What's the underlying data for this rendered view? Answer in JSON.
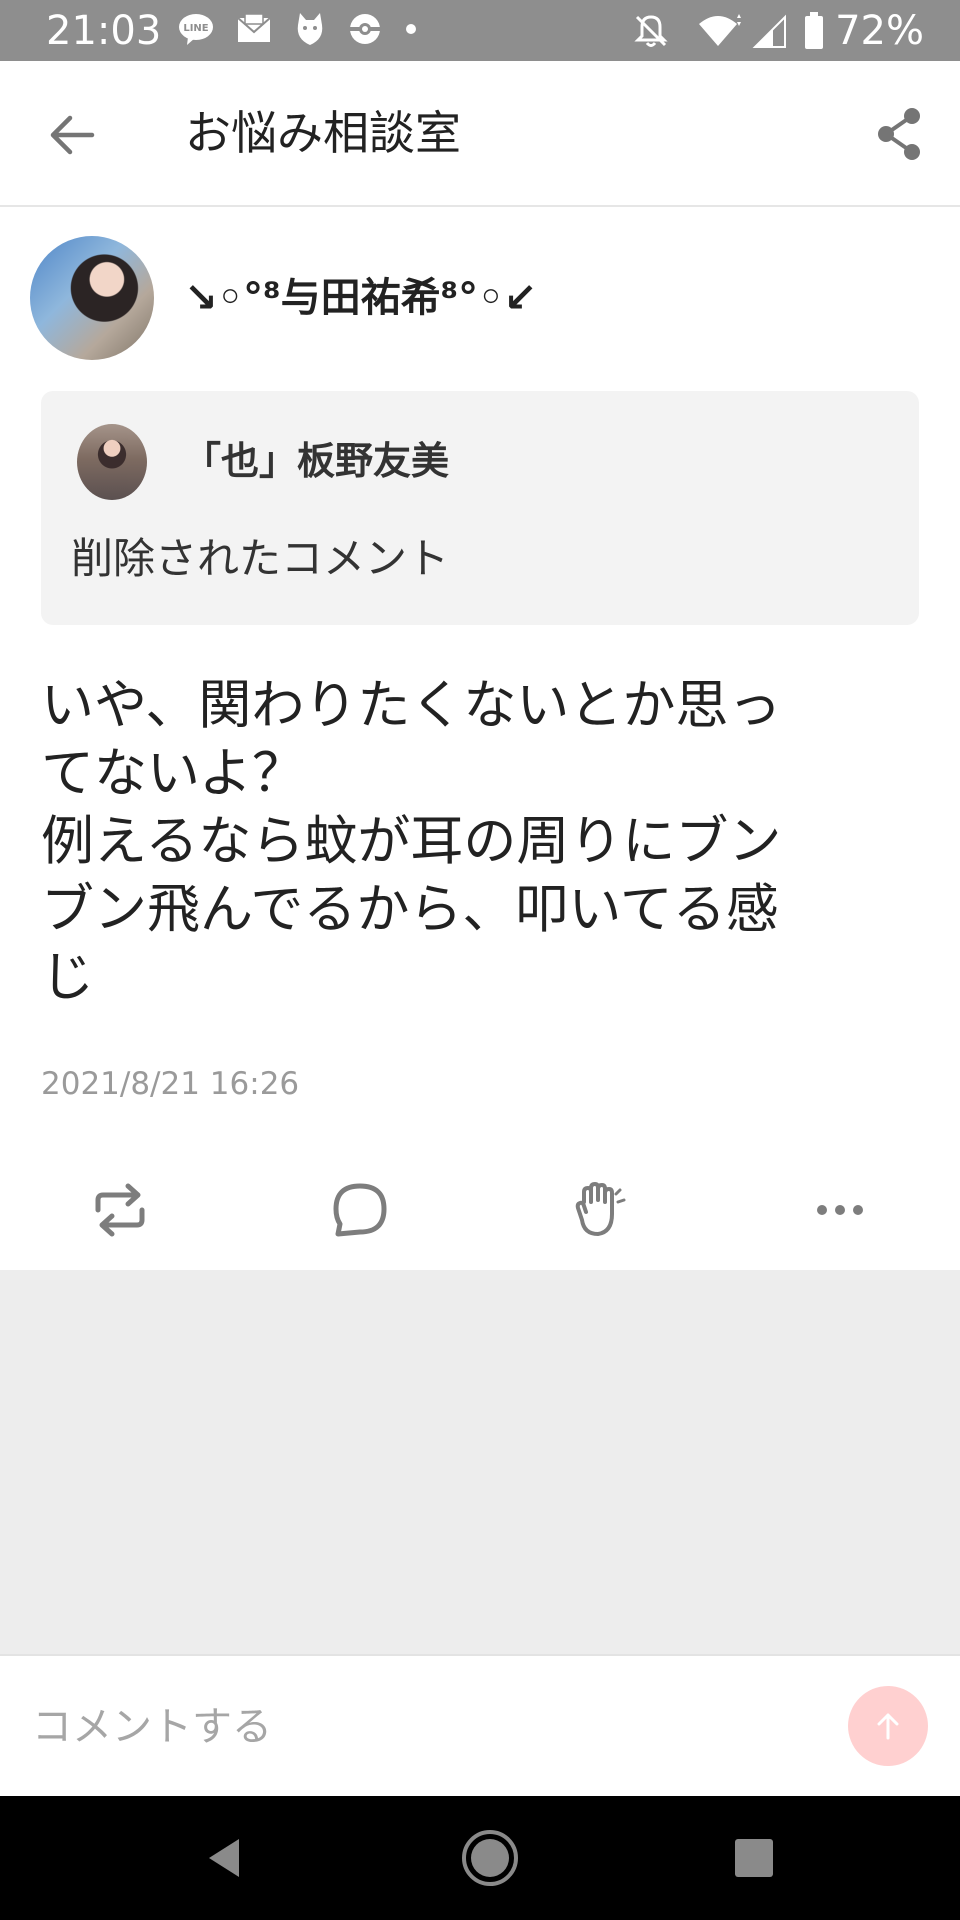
{
  "status_bar": {
    "time": "21:03",
    "battery": "72%",
    "left_icons": [
      "line-app-icon",
      "mail-icon",
      "cat-app-icon",
      "pokeball-icon",
      "dot-icon"
    ],
    "right_icons": [
      "notifications-off-icon",
      "wifi-icon",
      "signal-icon",
      "battery-icon"
    ]
  },
  "app_bar": {
    "title": "お悩み相談室",
    "back_icon": "arrow-left-icon",
    "share_icon": "share-icon"
  },
  "post": {
    "author": "↘︎◦°⁸与田祐希⁸°◦↙",
    "quoted": {
      "author": "「也」板野友美",
      "text": "削除されたコメント"
    },
    "body_lines": [
      "いや、関わりたくないとか思っ",
      "てないよ？",
      "例えるなら蚊が耳の周りにブン",
      "ブン飛んでるから、叩いてる感",
      "じ"
    ],
    "timestamp": "2021/8/21 16:26",
    "actions": [
      "repost-icon",
      "comment-icon",
      "clap-icon",
      "more-icon"
    ]
  },
  "comment_bar": {
    "placeholder": "コメントする",
    "send_icon": "arrow-up-icon"
  },
  "nav_bar": {
    "buttons": [
      "back-triangle-icon",
      "home-circle-icon",
      "recents-square-icon"
    ]
  },
  "colors": {
    "status_bar": "#8e8e8e",
    "background_gray": "#ededed",
    "quote_background": "#f3f3f3",
    "send_button": "#ffd0d0",
    "timestamp": "#9a9a9a"
  }
}
